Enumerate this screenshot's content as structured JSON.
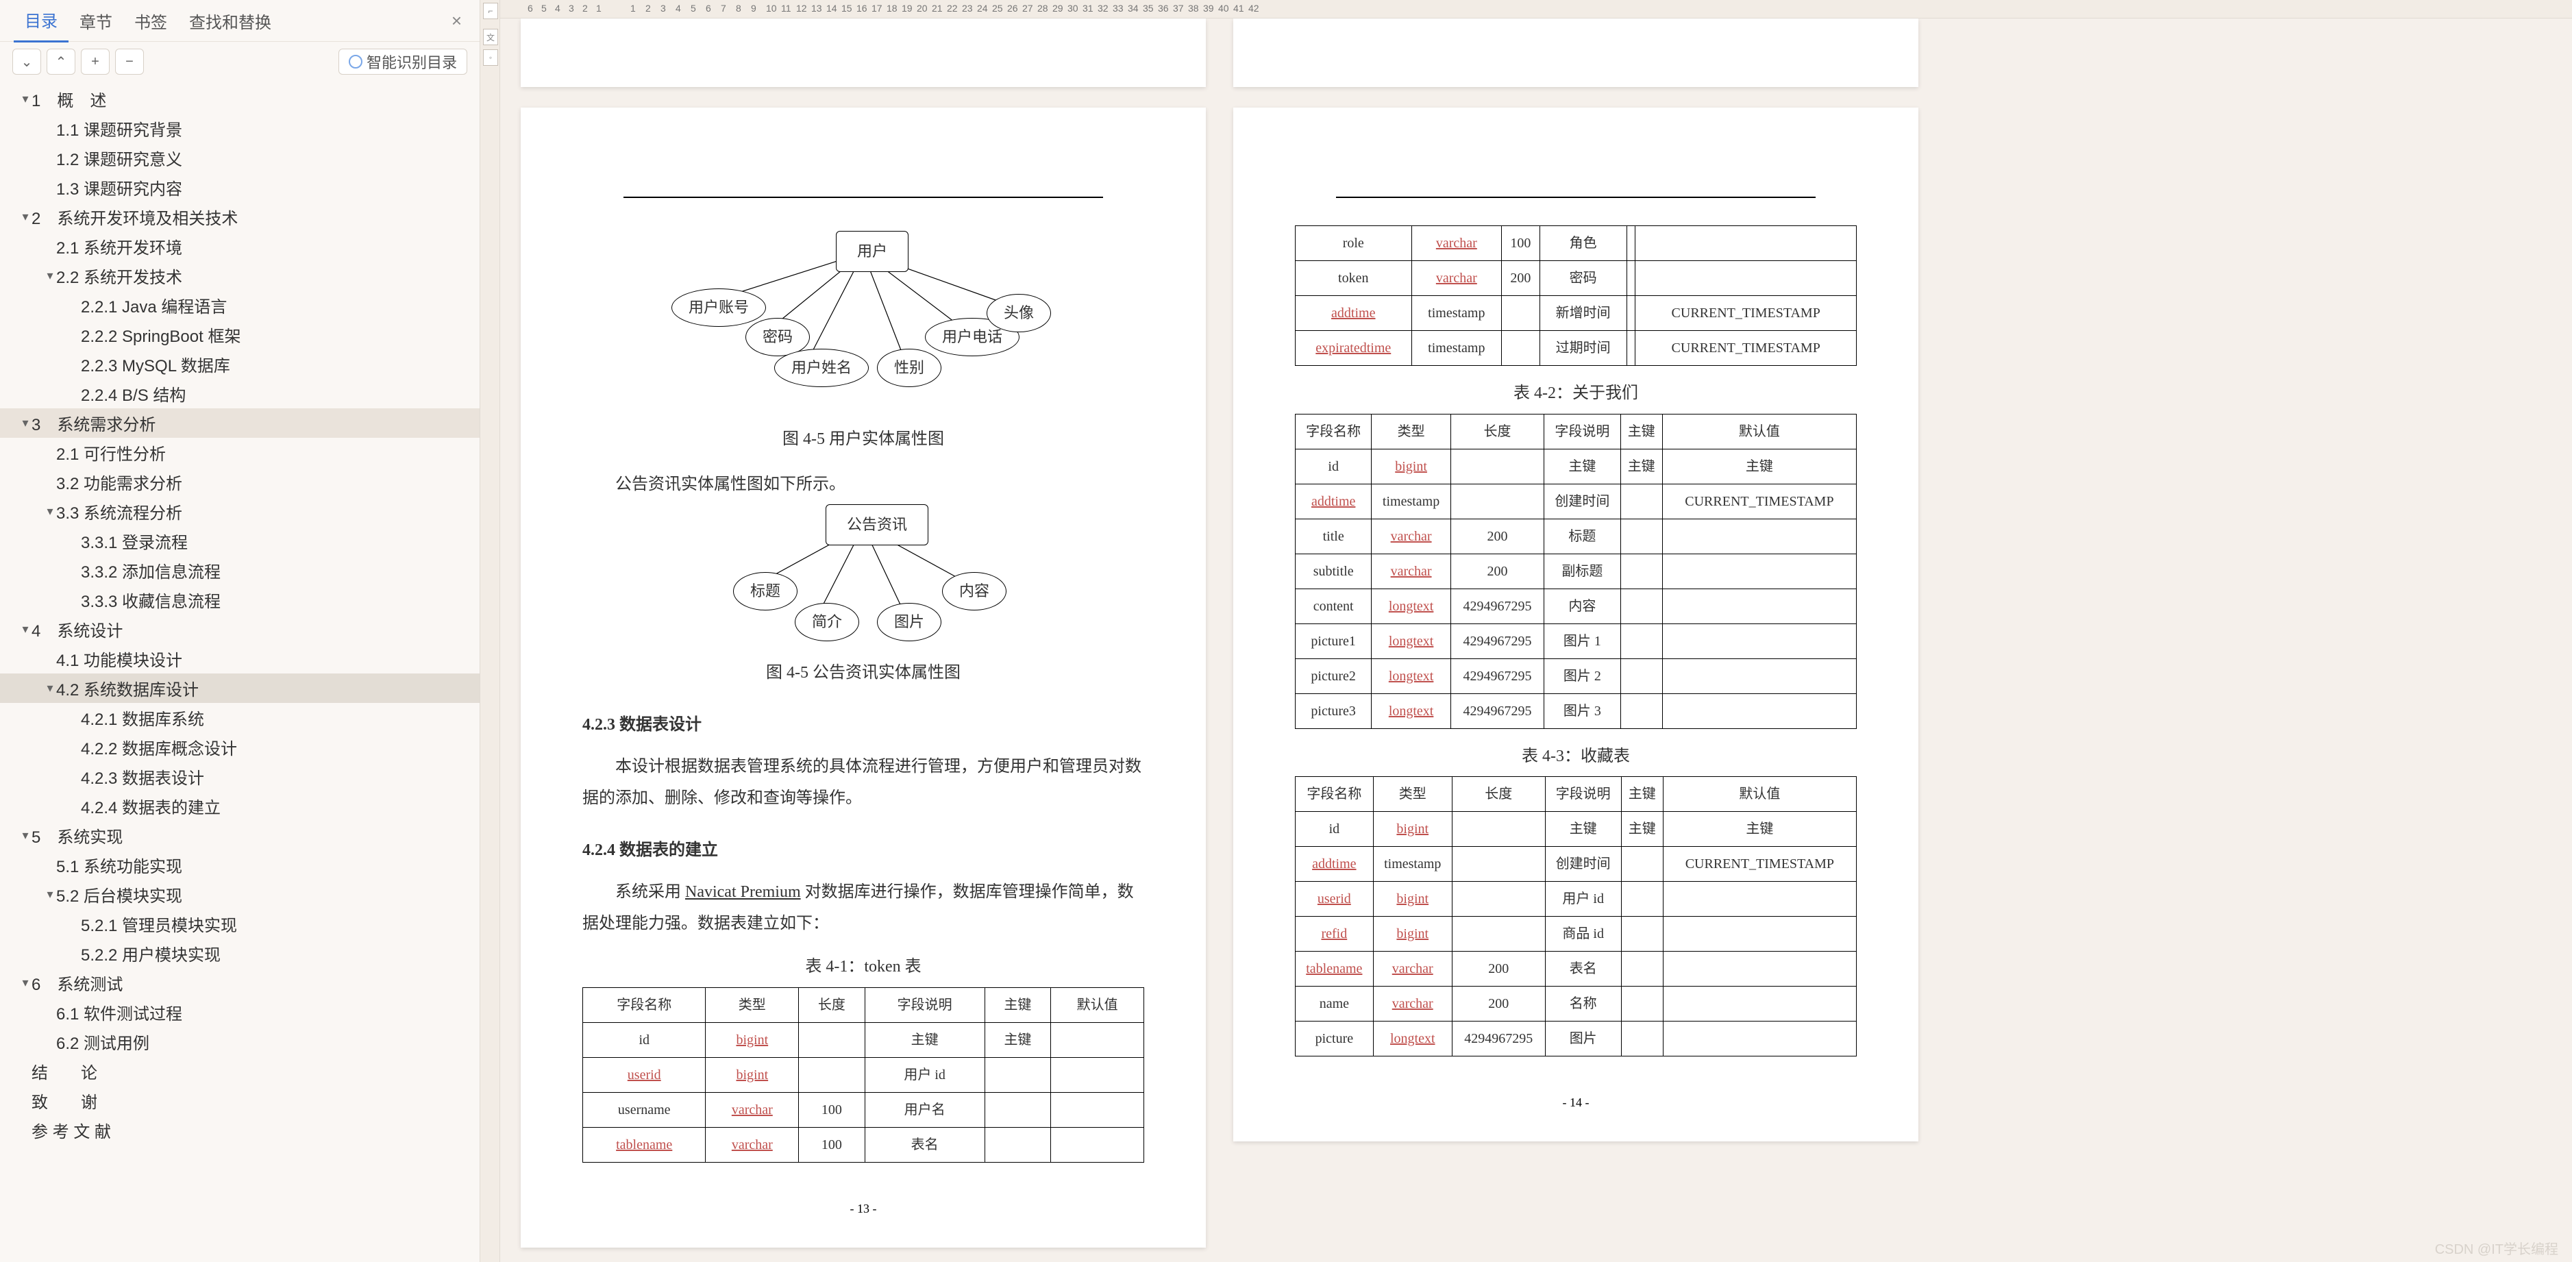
{
  "tabs": {
    "toc": "目录",
    "chapters": "章节",
    "bookmarks": "书签",
    "findreplace": "查找和替换"
  },
  "toolbar": {
    "down": "⌄",
    "up": "⌃",
    "plus": "+",
    "minus": "−",
    "smart": "智能识别目录"
  },
  "outline": [
    {
      "lvl": 0,
      "caret": "▾",
      "t": "1　概　述"
    },
    {
      "lvl": 1,
      "caret": "",
      "t": "1.1 课题研究背景"
    },
    {
      "lvl": 1,
      "caret": "",
      "t": "1.2 课题研究意义"
    },
    {
      "lvl": 1,
      "caret": "",
      "t": "1.3 课题研究内容"
    },
    {
      "lvl": 0,
      "caret": "▾",
      "t": "2　系统开发环境及相关技术"
    },
    {
      "lvl": 1,
      "caret": "",
      "t": "2.1 系统开发环境"
    },
    {
      "lvl": 1,
      "caret": "▾",
      "t": "2.2 系统开发技术"
    },
    {
      "lvl": 2,
      "caret": "",
      "t": "2.2.1 Java 编程语言"
    },
    {
      "lvl": 2,
      "caret": "",
      "t": "2.2.2 SpringBoot 框架"
    },
    {
      "lvl": 2,
      "caret": "",
      "t": "2.2.3 MySQL 数据库"
    },
    {
      "lvl": 2,
      "caret": "",
      "t": "2.2.4 B/S 结构"
    },
    {
      "lvl": 0,
      "caret": "▾",
      "t": "3　系统需求分析",
      "hl": true
    },
    {
      "lvl": 1,
      "caret": "",
      "t": "2.1 可行性分析"
    },
    {
      "lvl": 1,
      "caret": "",
      "t": "3.2 功能需求分析"
    },
    {
      "lvl": 1,
      "caret": "▾",
      "t": "3.3 系统流程分析"
    },
    {
      "lvl": 2,
      "caret": "",
      "t": "3.3.1 登录流程"
    },
    {
      "lvl": 2,
      "caret": "",
      "t": "3.3.2 添加信息流程"
    },
    {
      "lvl": 2,
      "caret": "",
      "t": "3.3.3 收藏信息流程"
    },
    {
      "lvl": 0,
      "caret": "▾",
      "t": "4　系统设计"
    },
    {
      "lvl": 1,
      "caret": "",
      "t": "4.1 功能模块设计"
    },
    {
      "lvl": 1,
      "caret": "▾",
      "t": "4.2 系统数据库设计",
      "sel": true
    },
    {
      "lvl": 2,
      "caret": "",
      "t": "4.2.1 数据库系统"
    },
    {
      "lvl": 2,
      "caret": "",
      "t": "4.2.2 数据库概念设计"
    },
    {
      "lvl": 2,
      "caret": "",
      "t": "4.2.3 数据表设计"
    },
    {
      "lvl": 2,
      "caret": "",
      "t": "4.2.4 数据表的建立"
    },
    {
      "lvl": 0,
      "caret": "▾",
      "t": "5　系统实现"
    },
    {
      "lvl": 1,
      "caret": "",
      "t": "5.1 系统功能实现"
    },
    {
      "lvl": 1,
      "caret": "▾",
      "t": "5.2 后台模块实现"
    },
    {
      "lvl": 2,
      "caret": "",
      "t": "5.2.1 管理员模块实现"
    },
    {
      "lvl": 2,
      "caret": "",
      "t": "5.2.2 用户模块实现"
    },
    {
      "lvl": 0,
      "caret": "▾",
      "t": "6　系统测试"
    },
    {
      "lvl": 1,
      "caret": "",
      "t": "6.1 软件测试过程"
    },
    {
      "lvl": 1,
      "caret": "",
      "t": "6.2 测试用例"
    },
    {
      "lvl": 0,
      "caret": "",
      "t": "结　　论"
    },
    {
      "lvl": 0,
      "caret": "",
      "t": "致　　谢"
    },
    {
      "lvl": 0,
      "caret": "",
      "t": "参 考 文 献"
    }
  ],
  "ruler_left": [
    "6",
    "5",
    "4",
    "3",
    "2",
    "1"
  ],
  "ruler_right": [
    "1",
    "2",
    "3",
    "4",
    "5",
    "6",
    "7",
    "8",
    "9",
    "10",
    "11",
    "12",
    "13",
    "14",
    "15",
    "16",
    "17",
    "18",
    "19",
    "20",
    "21",
    "22",
    "23",
    "24",
    "25",
    "26",
    "27",
    "28",
    "29",
    "30",
    "31",
    "32",
    "33",
    "34",
    "35",
    "36",
    "37",
    "38",
    "39",
    "40",
    "41",
    "42"
  ],
  "pageL": {
    "erd1_root": "用户",
    "erd1_nodes": [
      "用户账号",
      "密码",
      "用户姓名",
      "性别",
      "用户电话",
      "头像"
    ],
    "cap1": "图 4-5 用户实体属性图",
    "para1": "公告资讯实体属性图如下所示。",
    "erd2_root": "公告资讯",
    "erd2_nodes": [
      "标题",
      "简介",
      "图片",
      "内容"
    ],
    "cap2": "图 4-5 公告资讯实体属性图",
    "h423": "4.2.3 数据表设计",
    "p2": "本设计根据数据表管理系统的具体流程进行管理，方便用户和管理员对数据的添加、删除、修改和查询等操作。",
    "h424": "4.2.4 数据表的建立",
    "p3a": "系统采用 ",
    "p3link": "Navicat Premium",
    "p3b": " 对数据库进行操作，数据库管理操作简单，数据处理能力强。数据表建立如下：",
    "tcap": "表 4-1：token 表",
    "thead": [
      "字段名称",
      "类型",
      "长度",
      "字段说明",
      "主键",
      "默认值"
    ],
    "rows": [
      [
        "id",
        "bigint",
        "",
        "主键",
        "主键",
        ""
      ],
      [
        "userid",
        "bigint",
        "",
        "用户 id",
        "",
        ""
      ],
      [
        "username",
        "varchar",
        "100",
        "用户名",
        "",
        ""
      ],
      [
        "tablename",
        "varchar",
        "100",
        "表名",
        "",
        ""
      ]
    ],
    "pgnum": "- 13 -"
  },
  "pageR": {
    "t1rows": [
      [
        "role",
        "varchar",
        "100",
        "角色",
        "",
        ""
      ],
      [
        "token",
        "varchar",
        "200",
        "密码",
        "",
        ""
      ],
      [
        "addtime",
        "timestamp",
        "",
        "新增时间",
        "",
        "CURRENT_TIMESTAMP"
      ],
      [
        "expiratedtime",
        "timestamp",
        "",
        "过期时间",
        "",
        "CURRENT_TIMESTAMP"
      ]
    ],
    "cap2": "表 4-2：关于我们",
    "thead": [
      "字段名称",
      "类型",
      "长度",
      "字段说明",
      "主键",
      "默认值"
    ],
    "t2rows": [
      [
        "id",
        "bigint",
        "",
        "主键",
        "主键",
        "主键"
      ],
      [
        "addtime",
        "timestamp",
        "",
        "创建时间",
        "",
        "CURRENT_TIMESTAMP"
      ],
      [
        "title",
        "varchar",
        "200",
        "标题",
        "",
        ""
      ],
      [
        "subtitle",
        "varchar",
        "200",
        "副标题",
        "",
        ""
      ],
      [
        "content",
        "longtext",
        "4294967295",
        "内容",
        "",
        ""
      ],
      [
        "picture1",
        "longtext",
        "4294967295",
        "图片 1",
        "",
        ""
      ],
      [
        "picture2",
        "longtext",
        "4294967295",
        "图片 2",
        "",
        ""
      ],
      [
        "picture3",
        "longtext",
        "4294967295",
        "图片 3",
        "",
        ""
      ]
    ],
    "cap3": "表 4-3：收藏表",
    "t3rows": [
      [
        "id",
        "bigint",
        "",
        "主键",
        "主键",
        "主键"
      ],
      [
        "addtime",
        "timestamp",
        "",
        "创建时间",
        "",
        "CURRENT_TIMESTAMP"
      ],
      [
        "userid",
        "bigint",
        "",
        "用户 id",
        "",
        ""
      ],
      [
        "refid",
        "bigint",
        "",
        "商品 id",
        "",
        ""
      ],
      [
        "tablename",
        "varchar",
        "200",
        "表名",
        "",
        ""
      ],
      [
        "name",
        "varchar",
        "200",
        "名称",
        "",
        ""
      ],
      [
        "picture",
        "longtext",
        "4294967295",
        "图片",
        "",
        ""
      ]
    ],
    "pgnum": "- 14 -"
  },
  "watermark": "CSDN @IT学长编程"
}
